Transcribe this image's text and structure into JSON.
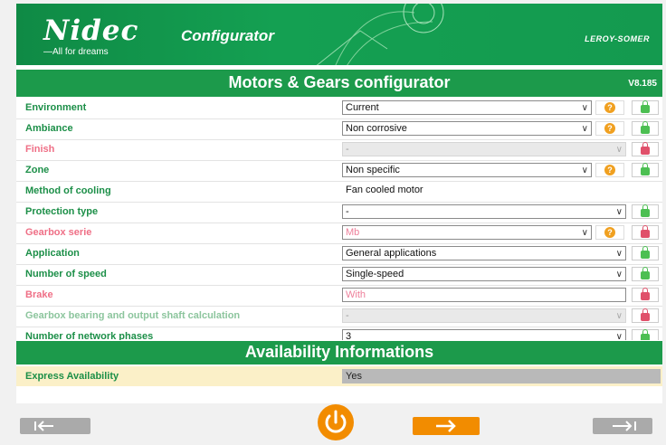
{
  "header": {
    "logo_text": "Nidec",
    "tagline": "—All for dreams",
    "app_title": "Configurator",
    "brand": "LEROY-SOMER"
  },
  "title_bar": {
    "title": "Motors & Gears configurator",
    "version": "V8.185"
  },
  "rows": [
    {
      "label": "Environment",
      "value": "Current",
      "state": "select",
      "help": true,
      "lock": "green"
    },
    {
      "label": "Ambiance",
      "value": "Non corrosive",
      "state": "select",
      "help": true,
      "lock": "green"
    },
    {
      "label": "Finish",
      "value": "-",
      "state": "disabled",
      "help": false,
      "lock": "red"
    },
    {
      "label": "Zone",
      "value": "Non specific",
      "state": "select",
      "help": true,
      "lock": "green"
    },
    {
      "label": "Method of cooling",
      "value": "Fan cooled motor",
      "state": "text",
      "help": false,
      "lock": null
    },
    {
      "label": "Protection type",
      "value": "-",
      "state": "select",
      "help": false,
      "lock": "green"
    },
    {
      "label": "Gearbox serie",
      "value": "Mb",
      "state": "select-pink",
      "help": true,
      "lock": "red"
    },
    {
      "label": "Application",
      "value": "General applications",
      "state": "select",
      "help": false,
      "lock": "green"
    },
    {
      "label": "Number of speed",
      "value": "Single-speed",
      "state": "select",
      "help": false,
      "lock": "green"
    },
    {
      "label": "Brake",
      "value": "With",
      "state": "pink-box",
      "help": false,
      "lock": "red"
    },
    {
      "label": "Gearbox bearing and output shaft calculation",
      "value": "-",
      "state": "disabled",
      "help": false,
      "lock": "red"
    },
    {
      "label": "Number of network phases",
      "value": "3",
      "state": "select",
      "help": false,
      "lock": "green"
    }
  ],
  "availability": {
    "title": "Availability Informations",
    "label": "Express Availability",
    "value": "Yes"
  },
  "colors": {
    "brand_green": "#1c9a4b",
    "accent_orange": "#f28c00",
    "lock_green": "#4cbf52",
    "lock_red": "#e0506a"
  },
  "icons": {
    "help": "question-icon",
    "lock_open": "padlock-open-icon",
    "lock_closed": "padlock-closed-icon",
    "first": "first-page-arrow-icon",
    "next": "next-arrow-icon",
    "last": "last-page-arrow-icon",
    "power": "power-icon"
  }
}
